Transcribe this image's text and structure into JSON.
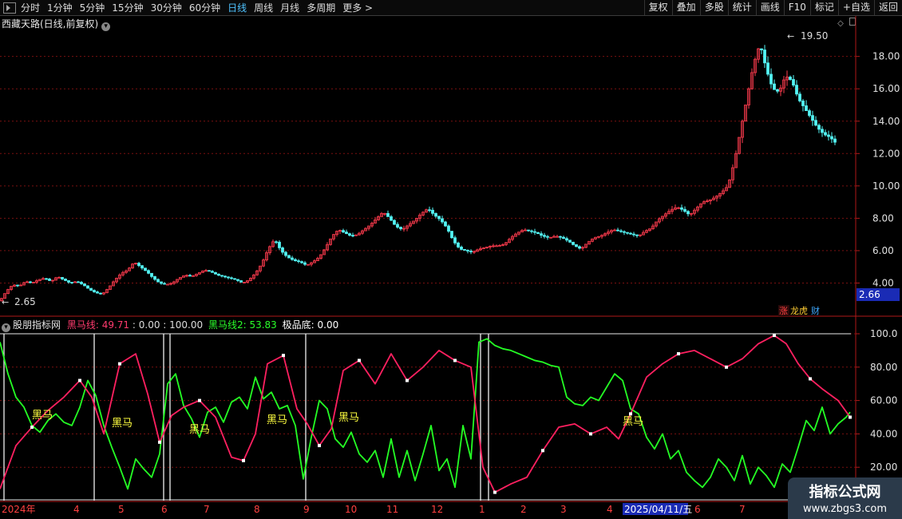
{
  "toolbar": {
    "periods": [
      "分时",
      "1分钟",
      "5分钟",
      "15分钟",
      "30分钟",
      "60分钟",
      "日线",
      "周线",
      "月线",
      "多周期",
      "更多"
    ],
    "active_period": "日线",
    "right_buttons": [
      "复权",
      "叠加",
      "多股",
      "统计",
      "画线",
      "F10",
      "标记",
      "+自选",
      "返回"
    ]
  },
  "chart_title": "西藏天路(日线,前复权)",
  "price_axis": {
    "ticks": [
      "18.00",
      "16.00",
      "14.00",
      "12.00",
      "10.00",
      "8.00",
      "6.00",
      "4.00"
    ],
    "high_label": "19.50",
    "low_label": "2.65",
    "current": "2.66"
  },
  "badges": [
    "涨",
    "龙虎",
    "财"
  ],
  "indicator": {
    "name": "股朋指标网",
    "line1_label": "黑马线: 49.71",
    "line1_rest": ": 0.00 : 100.00",
    "line2_label": "黑马线2: 53.83",
    "bottom_label": "极品底: 0.00",
    "axis_ticks": [
      "100.0",
      "80.00",
      "60.00",
      "40.00",
      "20.00"
    ],
    "heima_label": "黑马"
  },
  "x_axis": {
    "labels": [
      "2024年",
      "4",
      "5",
      "6",
      "7",
      "8",
      "9",
      "10",
      "11",
      "12",
      "1",
      "2",
      "3",
      "4",
      "2025/04/11/五",
      "6",
      "7"
    ]
  },
  "watermark": {
    "line1": "指标公式网",
    "line2": "www.zbgs3.com"
  },
  "colors": {
    "red": "#ff3b4e",
    "cyan": "#53f3f3",
    "green": "#24ff24",
    "pink": "#ff2060",
    "grid": "#7a1010",
    "axis_red": "#b01818"
  },
  "chart_data": [
    {
      "type": "line",
      "title": "西藏天路(日线,前复权)",
      "ylim": [
        2.0,
        20.5
      ],
      "x": [
        0,
        8,
        16,
        24,
        32,
        40,
        48,
        56,
        64,
        72,
        80,
        88,
        96,
        104,
        112,
        120,
        128,
        136,
        144,
        152,
        160,
        168,
        176,
        184,
        192,
        200,
        208,
        216,
        224,
        232,
        240,
        248,
        256,
        264,
        272,
        280,
        288,
        296,
        304,
        312,
        320,
        328,
        336,
        344,
        352,
        360,
        368,
        376,
        384,
        392,
        400,
        408,
        416,
        424,
        432,
        440,
        448,
        456,
        464,
        472,
        480,
        488,
        496,
        504,
        512,
        520,
        528,
        536,
        544,
        552,
        560,
        568,
        576,
        584,
        592,
        600,
        608,
        616,
        624,
        632,
        640,
        648,
        656,
        664,
        672,
        680,
        688,
        696,
        704,
        712,
        720,
        728,
        736,
        744,
        752,
        760,
        768,
        776,
        784,
        792,
        800,
        808,
        816,
        824,
        832,
        840,
        848,
        856,
        864,
        872,
        880,
        888,
        896,
        904,
        912,
        920,
        928,
        936,
        944,
        952,
        960,
        968,
        976,
        984,
        992,
        1000,
        1008,
        1016,
        1024,
        1032,
        1040,
        1048,
        1056,
        1064
      ],
      "values": [
        2.9,
        3.5,
        3.9,
        3.8,
        4.1,
        4.0,
        4.2,
        4.3,
        4.1,
        4.4,
        4.2,
        4.0,
        4.1,
        3.9,
        3.6,
        3.4,
        3.3,
        3.7,
        4.2,
        4.6,
        4.8,
        5.3,
        5.0,
        4.7,
        4.3,
        4.0,
        3.9,
        4.0,
        4.3,
        4.5,
        4.4,
        4.6,
        4.8,
        4.7,
        4.5,
        4.4,
        4.3,
        4.2,
        4.0,
        4.2,
        4.6,
        5.2,
        6.1,
        6.7,
        6.0,
        5.6,
        5.4,
        5.3,
        5.1,
        5.3,
        5.6,
        6.2,
        6.9,
        7.3,
        7.1,
        6.9,
        7.0,
        7.3,
        7.6,
        8.0,
        8.4,
        8.0,
        7.5,
        7.3,
        7.6,
        7.9,
        8.3,
        8.6,
        8.2,
        7.9,
        7.4,
        6.6,
        6.1,
        6.0,
        5.9,
        6.1,
        6.2,
        6.3,
        6.3,
        6.4,
        6.8,
        7.1,
        7.3,
        7.2,
        7.1,
        6.9,
        6.8,
        6.9,
        6.8,
        6.6,
        6.3,
        6.1,
        6.5,
        6.8,
        6.9,
        7.1,
        7.3,
        7.2,
        7.1,
        7.0,
        6.9,
        7.2,
        7.4,
        7.9,
        8.2,
        8.5,
        8.7,
        8.5,
        8.2,
        8.6,
        9.0,
        9.1,
        9.3,
        9.6,
        10.0,
        11.5,
        13.5,
        15.5,
        17.5,
        18.8,
        17.2,
        16.0,
        15.8,
        16.8,
        16.5,
        15.4,
        14.8,
        14.2,
        13.6,
        13.2,
        13.0,
        12.6
      ]
    },
    {
      "type": "line",
      "title": "股朋指标网",
      "ylim": [
        0,
        100
      ],
      "series": [
        {
          "name": "黑马线",
          "x": [
            0,
            20,
            40,
            60,
            80,
            100,
            115,
            130,
            150,
            170,
            185,
            200,
            215,
            230,
            250,
            270,
            290,
            305,
            320,
            335,
            355,
            372,
            385,
            400,
            415,
            430,
            450,
            470,
            490,
            510,
            530,
            550,
            570,
            590,
            605,
            620,
            640,
            660,
            680,
            700,
            720,
            740,
            760,
            775,
            790,
            810,
            830,
            850,
            870,
            890,
            910,
            930,
            950,
            970,
            985,
            1000,
            1015,
            1030,
            1050,
            1065
          ],
          "values": [
            7,
            33,
            44,
            54,
            62,
            72,
            62,
            40,
            82,
            88,
            64,
            35,
            51,
            56,
            60,
            50,
            26,
            24,
            40,
            82,
            87,
            55,
            46,
            33,
            43,
            78,
            84,
            70,
            88,
            72,
            80,
            90,
            84,
            80,
            20,
            5,
            10,
            14,
            30,
            44,
            46,
            40,
            44,
            37,
            52,
            74,
            82,
            88,
            90,
            85,
            80,
            85,
            94,
            99,
            94,
            82,
            73,
            67,
            60,
            50
          ]
        },
        {
          "name": "黑马线2",
          "x": [
            0,
            10,
            20,
            30,
            40,
            50,
            60,
            70,
            80,
            90,
            100,
            110,
            120,
            130,
            140,
            150,
            160,
            170,
            180,
            190,
            200,
            210,
            220,
            230,
            240,
            250,
            260,
            270,
            280,
            290,
            300,
            310,
            320,
            330,
            340,
            350,
            360,
            370,
            380,
            390,
            400,
            410,
            420,
            430,
            440,
            450,
            460,
            470,
            480,
            490,
            500,
            510,
            520,
            530,
            540,
            550,
            560,
            570,
            580,
            590,
            600,
            610,
            620,
            630,
            640,
            650,
            660,
            670,
            680,
            690,
            700,
            710,
            720,
            730,
            740,
            750,
            760,
            770,
            780,
            790,
            800,
            810,
            820,
            830,
            840,
            850,
            860,
            870,
            880,
            890,
            900,
            910,
            920,
            930,
            940,
            950,
            960,
            970,
            980,
            990,
            1000,
            1010,
            1020,
            1030,
            1040,
            1050,
            1060,
            1065
          ],
          "values": [
            95,
            76,
            62,
            56,
            45,
            41,
            48,
            52,
            47,
            45,
            56,
            72,
            63,
            45,
            32,
            20,
            7,
            25,
            19,
            14,
            28,
            70,
            76,
            57,
            49,
            38,
            53,
            56,
            47,
            59,
            62,
            55,
            74,
            61,
            65,
            55,
            57,
            45,
            13,
            38,
            60,
            55,
            37,
            32,
            41,
            28,
            23,
            30,
            14,
            37,
            14,
            30,
            12,
            28,
            45,
            18,
            25,
            8,
            45,
            25,
            95,
            97,
            93,
            91,
            90,
            88,
            86,
            84,
            83,
            81,
            80,
            62,
            58,
            57,
            62,
            60,
            68,
            76,
            72,
            55,
            52,
            38,
            31,
            40,
            25,
            30,
            17,
            12,
            8,
            14,
            25,
            20,
            12,
            27,
            10,
            20,
            15,
            8,
            22,
            17,
            32,
            48,
            42,
            56,
            40,
            46,
            50,
            53
          ]
        },
        {
          "name": "极品底",
          "x": [
            5,
            118,
            205,
            213,
            383,
            602,
            612
          ],
          "values": [
            100,
            100,
            100,
            100,
            100,
            100,
            100
          ]
        }
      ]
    }
  ]
}
